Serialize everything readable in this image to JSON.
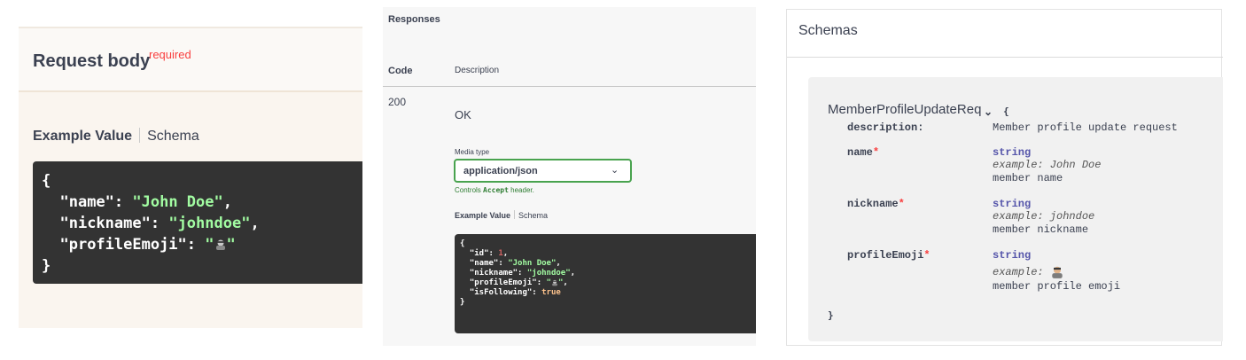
{
  "request_body": {
    "title": "Request body",
    "required_label": "required",
    "tab_example": "Example Value",
    "tab_schema": "Schema",
    "json": {
      "open": "{",
      "close": "}",
      "lines": [
        {
          "key": "\"name\"",
          "value": "\"John Doe\"",
          "suffix": ","
        },
        {
          "key": "\"nickname\"",
          "value": "\"johndoe\"",
          "suffix": ","
        },
        {
          "key": "\"profileEmoji\"",
          "value_prefix": "\"",
          "value_suffix": "\"",
          "emoji": "person-emoji"
        }
      ]
    }
  },
  "responses": {
    "title": "Responses",
    "col_code": "Code",
    "col_description": "Description",
    "status": "200",
    "status_text": "OK",
    "media_type_label": "Media type",
    "media_type_value": "application/json",
    "controls_prefix": "Controls ",
    "controls_accept": "Accept",
    "controls_suffix": " header.",
    "tab_example": "Example Value",
    "tab_schema": "Schema",
    "json": {
      "open": "{",
      "close": "}",
      "lines": [
        {
          "key": "\"id\"",
          "value": "1",
          "suffix": ","
        },
        {
          "key": "\"name\"",
          "value": "\"John Doe\"",
          "suffix": ","
        },
        {
          "key": "\"nickname\"",
          "value": "\"johndoe\"",
          "suffix": ","
        },
        {
          "key": "\"profileEmoji\"",
          "value_prefix": "\"",
          "value_suffix": "\"",
          "suffix": ",",
          "emoji": "person-emoji"
        },
        {
          "key": "\"isFollowing\"",
          "value": "true"
        }
      ]
    }
  },
  "schemas": {
    "title": "Schemas",
    "model_name": "MemberProfileUpdateReq",
    "open_brace": "{",
    "close_brace": "}",
    "description_key": "description:",
    "description_value": "Member profile update request",
    "properties": [
      {
        "name": "name",
        "type": "string",
        "example": "example: John Doe",
        "description": "member name"
      },
      {
        "name": "nickname",
        "type": "string",
        "example": "example: johndoe",
        "description": "member nickname"
      },
      {
        "name": "profileEmoji",
        "type": "string",
        "example": "example:",
        "emoji": "person-emoji",
        "description": "member profile emoji"
      }
    ],
    "required_mark": "*"
  },
  "colors": {
    "json_key": "#ffffff",
    "json_string": "#a2fca2",
    "json_number": "#d36363",
    "json_bool": "#fcc28c",
    "required": "#f93e3e",
    "select_border": "#49a34f"
  }
}
